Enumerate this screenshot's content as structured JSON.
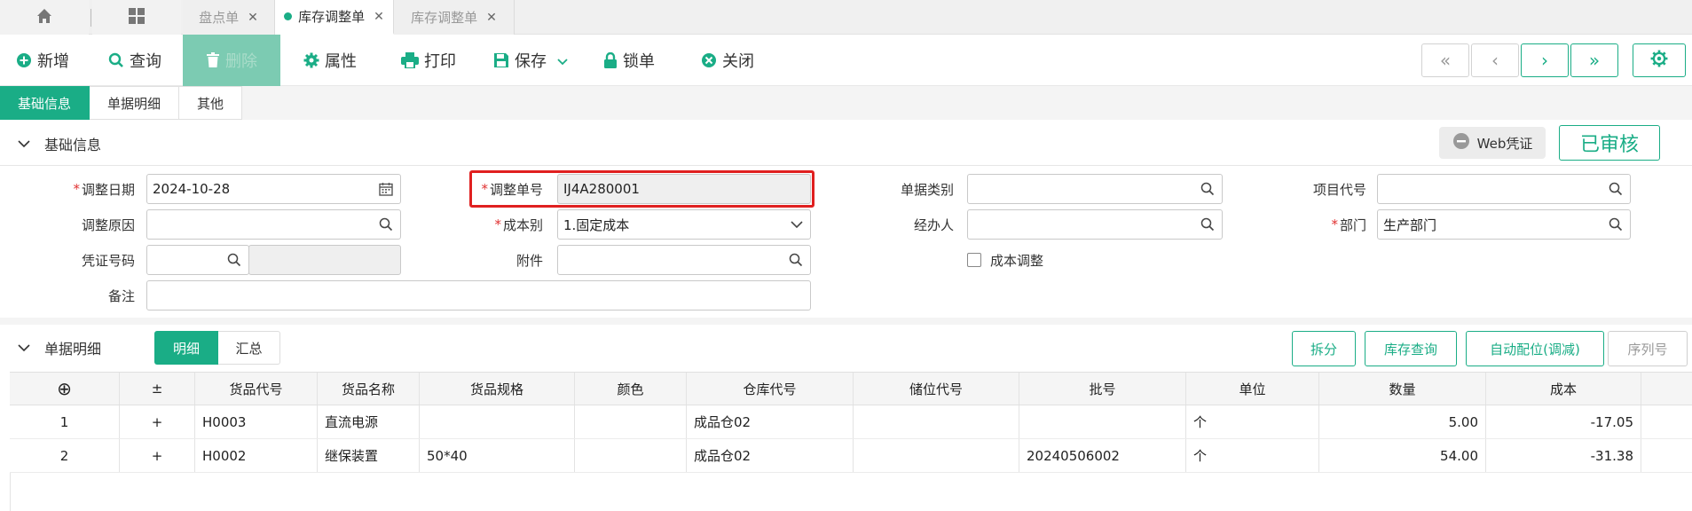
{
  "tabs": {
    "items": [
      {
        "label": "盘点单",
        "close": "✕"
      },
      {
        "label": "库存调整单",
        "close": "✕"
      },
      {
        "label": "库存调整单",
        "close": "✕"
      }
    ]
  },
  "toolbar": {
    "add": "新增",
    "query": "查询",
    "delete": "删除",
    "props": "属性",
    "print": "打印",
    "save": "保存",
    "lock": "锁单",
    "close": "关闭"
  },
  "section_tabs": [
    "基础信息",
    "单据明细",
    "其他"
  ],
  "basic": {
    "title": "基础信息",
    "web_voucher": "Web凭证",
    "status": "已审核",
    "fields": {
      "adjust_date": {
        "label": "调整日期",
        "value": "2024-10-28"
      },
      "adjust_no": {
        "label": "调整单号",
        "value": "IJ4A280001"
      },
      "doc_type": {
        "label": "单据类别",
        "value": ""
      },
      "project_code": {
        "label": "项目代号",
        "value": ""
      },
      "adjust_reason": {
        "label": "调整原因",
        "value": ""
      },
      "cost_type": {
        "label": "成本别",
        "value": "1.固定成本"
      },
      "handler": {
        "label": "经办人",
        "value": ""
      },
      "department": {
        "label": "部门",
        "value": "生产部门"
      },
      "voucher_no": {
        "label": "凭证号码",
        "value": ""
      },
      "attachment": {
        "label": "附件",
        "value": ""
      },
      "cost_adjust": {
        "label": "成本调整"
      },
      "remark": {
        "label": "备注",
        "value": ""
      }
    }
  },
  "detail": {
    "title": "单据明细",
    "tab_detail": "明细",
    "tab_summary": "汇总",
    "btn_split": "拆分",
    "btn_stock_query": "库存查询",
    "btn_auto_alloc": "自动配位(调减)",
    "btn_serial": "序列号",
    "columns": {
      "add": "⊕",
      "pm": "±",
      "code": "货品代号",
      "name": "货品名称",
      "spec": "货品规格",
      "color": "颜色",
      "warehouse": "仓库代号",
      "location": "储位代号",
      "batch": "批号",
      "unit": "单位",
      "qty": "数量",
      "cost": "成本"
    },
    "rows": [
      {
        "no": "1",
        "pm": "+",
        "code": "H0003",
        "name": "直流电源",
        "spec": "",
        "color": "",
        "warehouse": "成品仓02",
        "location": "",
        "batch": "",
        "unit": "个",
        "qty": "5.00",
        "cost": "-17.05"
      },
      {
        "no": "2",
        "pm": "+",
        "code": "H0002",
        "name": "继保装置",
        "spec": "50*40",
        "color": "",
        "warehouse": "成品仓02",
        "location": "",
        "batch": "20240506002",
        "unit": "个",
        "qty": "54.00",
        "cost": "-31.38"
      }
    ]
  },
  "colors": {
    "accent": "#1aad86",
    "required": "#e03030",
    "highlight": "#e02020"
  }
}
